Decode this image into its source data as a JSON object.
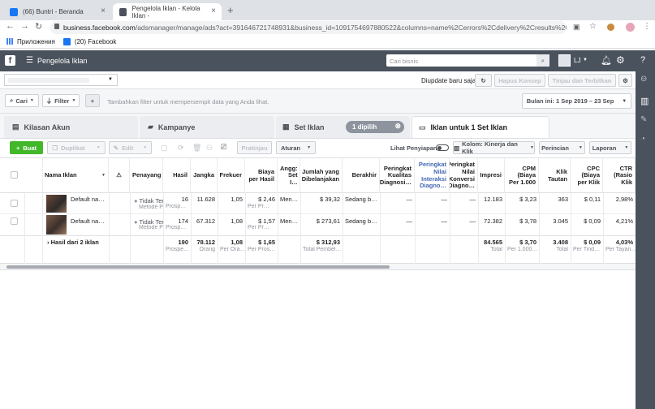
{
  "browser": {
    "tabs": [
      {
        "title": "(66) Buntri - Beranda"
      },
      {
        "title": "Pengelola Iklan - Kelola Iklan -"
      }
    ],
    "url_host": "business.facebook.com",
    "url_path": "/adsmanager/manage/ads?act=391646721748931&business_id=1091754697880522&columns=name%2Cerrors%2Cdelivery%2Cresults%2Cr...",
    "bookmarks": [
      {
        "label": "Приложения"
      },
      {
        "label": "(20) Facebook"
      }
    ]
  },
  "header": {
    "title": "Pengelola Iklan",
    "search_placeholder": "Cari bisnis",
    "user_initials": "LJ"
  },
  "toolbar1": {
    "updated": "Diupdate baru saja",
    "draft_btn": "Hapus Konsep",
    "review_btn": "Tinjau dan Terbitkan"
  },
  "toolbar2": {
    "search": "Cari",
    "filter": "Filter",
    "placeholder": "Tambahkan filter untuk mempersempit data yang Anda lihat.",
    "date_range": "Bulan ini: 1 Sep 2019 – 23 Sep"
  },
  "levels": {
    "account": "Kilasan Akun",
    "campaigns": "Kampanye",
    "adsets": "Set Iklan",
    "selected": "1 dipilih",
    "ads": "Iklan untuk 1 Set Iklan"
  },
  "actions": {
    "create": "Buat",
    "duplicate": "Duplikat",
    "edit": "Edit",
    "preview": "Pratinjau",
    "rules": "Aturan",
    "view_setup": "Lihat Penyiapan",
    "columns": "Kolom: Kinerja dan Klik",
    "breakdown": "Perincian",
    "reports": "Laporan"
  },
  "columns": [
    {
      "label": "Nama Iklan"
    },
    {
      "label": "Penayang"
    },
    {
      "label": "Hasil"
    },
    {
      "label": "Jangka"
    },
    {
      "label": "Frekuer"
    },
    {
      "label": "Biaya per Hasil"
    },
    {
      "label": "Angg: Set I…"
    },
    {
      "label": "Jumlah yang Dibelanjakan"
    },
    {
      "label": "Berakhir"
    },
    {
      "label": "Peringkat Kualitas Diagnosi…"
    },
    {
      "label": "Peringkat Nilai Interaksi Diagno…"
    },
    {
      "label": "Peringkat Nilai Konversi Diagno…"
    },
    {
      "label": "Impresi"
    },
    {
      "label": "CPM (Biaya Per 1.000"
    },
    {
      "label": "Klik Tautan"
    },
    {
      "label": "CPC (Biaya per Klik"
    },
    {
      "label": "CTR (Rasio Klik"
    }
  ],
  "rows": [
    {
      "name": "Default na…",
      "delivery": "Tidak Terb…",
      "delivery_sub": "Metode P…",
      "results": "16",
      "results_sub": "Prosp…",
      "reach": "11.628",
      "freq": "1,05",
      "cpr": "$ 2,46",
      "cpr_sub": "Per Pr…",
      "budget": "Men…",
      "spent": "$ 39,32",
      "ends": "Sedang b…",
      "q": "—",
      "e": "—",
      "c": "—",
      "impr": "12.183",
      "cpm": "$ 3,23",
      "clicks": "363",
      "cpc": "$ 0,11",
      "ctr": "2,98%"
    },
    {
      "name": "Default na…",
      "delivery": "Tidak Terb…",
      "delivery_sub": "Metode P…",
      "results": "174",
      "results_sub": "Prosp…",
      "reach": "67.312",
      "freq": "1,08",
      "cpr": "$ 1,57",
      "cpr_sub": "Per Pr…",
      "budget": "Men…",
      "spent": "$ 273,61",
      "ends": "Sedang b…",
      "q": "—",
      "e": "—",
      "c": "—",
      "impr": "72.382",
      "cpm": "$ 3,78",
      "clicks": "3.045",
      "cpc": "$ 0,09",
      "ctr": "4,21%"
    }
  ],
  "total": {
    "name": "Hasil dari 2 iklan",
    "results": "190",
    "results_sub": "Prospe…",
    "reach": "78.112",
    "reach_sub": "Orang",
    "freq": "1,08",
    "freq_sub": "Per Ora…",
    "cpr": "$ 1,65",
    "cpr_sub": "Per Pros…",
    "spent": "$ 312,93",
    "spent_sub": "Total Pembel…",
    "impr": "84.565",
    "impr_sub": "Total",
    "cpm": "$ 3,70",
    "cpm_sub": "Per 1.000…",
    "clicks": "3.408",
    "clicks_sub": "Total",
    "cpc": "$ 0,09",
    "cpc_sub": "Per Tind…",
    "ctr": "4,03%",
    "ctr_sub": "Per Tayan…"
  }
}
